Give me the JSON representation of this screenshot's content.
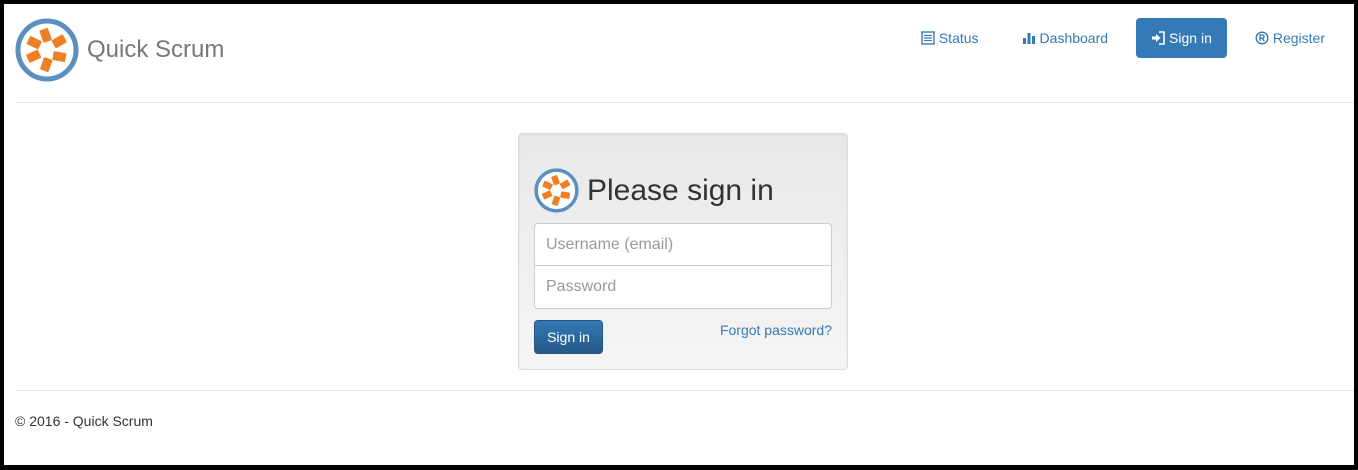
{
  "app": {
    "name": "Quick Scrum",
    "logo_icon": "quick-scrum-logo-icon",
    "colors": {
      "brand_blue": "#5b8fc0",
      "brand_orange": "#ef7f24",
      "accent": "#337ab7"
    }
  },
  "nav": {
    "items": [
      {
        "label": "Status",
        "icon": "list-icon"
      },
      {
        "label": "Dashboard",
        "icon": "bar-chart-icon"
      },
      {
        "label": "Sign in",
        "icon": "sign-in-icon",
        "active": true
      },
      {
        "label": "Register",
        "icon": "registered-icon"
      }
    ]
  },
  "signin": {
    "title": "Please sign in",
    "username_placeholder": "Username (email)",
    "password_placeholder": "Password",
    "submit_label": "Sign in",
    "forgot_label": "Forgot password?"
  },
  "footer": {
    "text": "© 2016 - Quick Scrum"
  }
}
